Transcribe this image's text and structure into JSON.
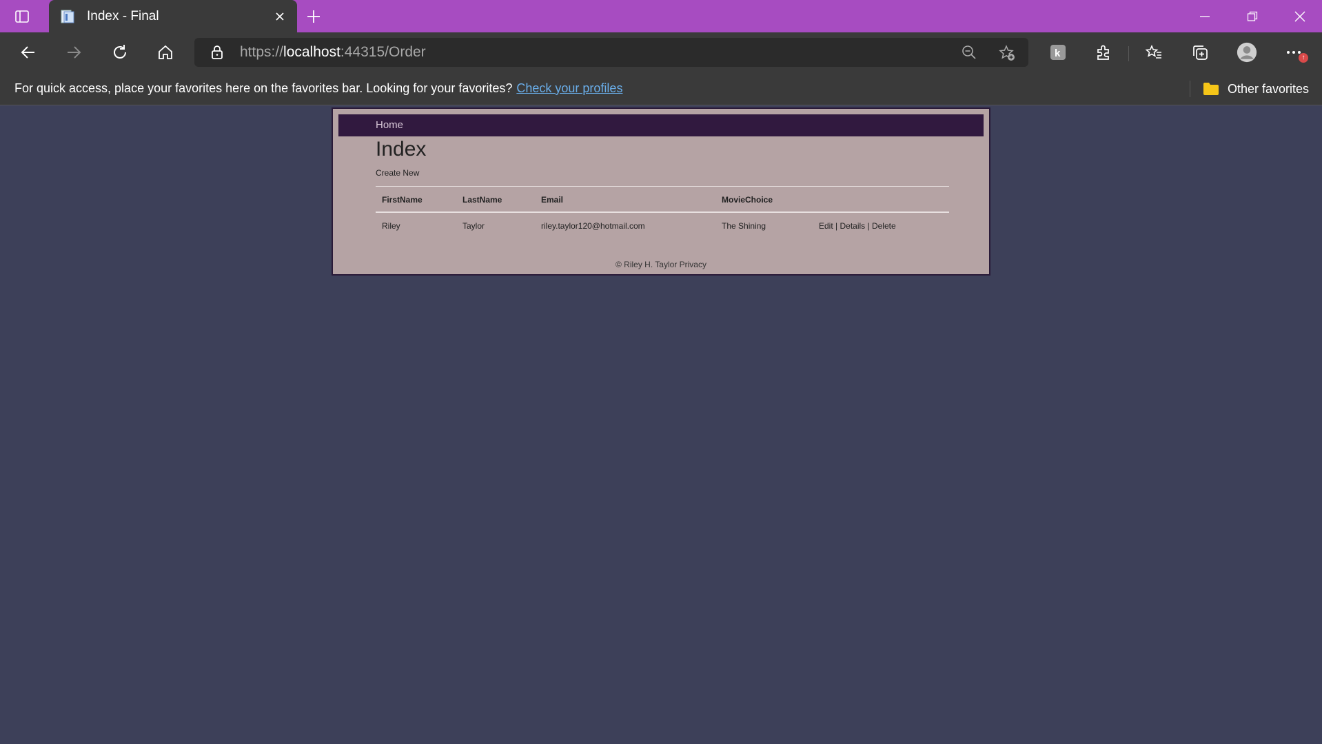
{
  "browser": {
    "tab_title": "Index - Final",
    "url_scheme": "https://",
    "url_host": "localhost",
    "url_path": ":44315/Order",
    "favorites_message": "For quick access, place your favorites here on the favorites bar. Looking for your favorites?",
    "favorites_link": "Check your profiles",
    "other_favorites": "Other favorites",
    "update_badge": "↑",
    "accent_color": "#a74cc1"
  },
  "site": {
    "nav_home": "Home",
    "heading": "Index",
    "create_new": "Create New",
    "footer": "© Riley H. Taylor Privacy"
  },
  "table": {
    "headers": [
      "FirstName",
      "LastName",
      "Email",
      "MovieChoice",
      ""
    ],
    "rows": [
      {
        "first_name": "Riley",
        "last_name": "Taylor",
        "email": "riley.taylor120@hotmail.com",
        "movie_choice": "The Shining",
        "actions": {
          "edit": "Edit",
          "details": "Details",
          "delete": "Delete",
          "separator": " | "
        }
      }
    ]
  }
}
